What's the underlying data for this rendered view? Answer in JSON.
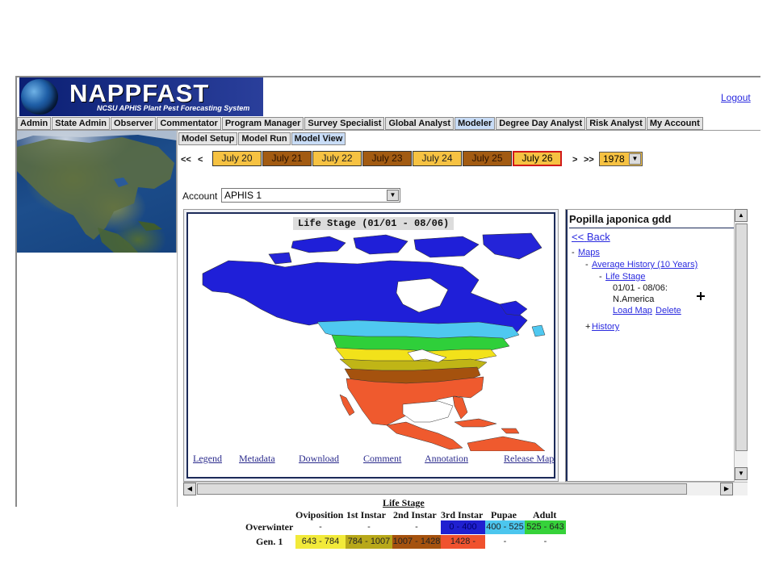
{
  "header": {
    "logo_title": "NAPPFAST",
    "logo_subtitle": "NCSU APHIS Plant Pest Forecasting System",
    "logout": "Logout"
  },
  "role_tabs": [
    "Admin",
    "State Admin",
    "Observer",
    "Commentator",
    "Program Manager",
    "Survey Specialist",
    "Global Analyst",
    "Modeler",
    "Degree Day Analyst",
    "Risk Analyst",
    "My Account"
  ],
  "active_role": "Modeler",
  "sub_tabs": [
    "Model Setup",
    "Model Run",
    "Model View"
  ],
  "active_sub_tab": "Model View",
  "date_nav": {
    "first": "<<",
    "prev": "<",
    "next": ">",
    "last": ">>",
    "days": [
      "July 20",
      "July 21",
      "July 22",
      "July 23",
      "July 24",
      "July 25",
      "July 26"
    ],
    "selected_day": "July 26",
    "year": "1978"
  },
  "account": {
    "label": "Account",
    "value": "APHIS 1"
  },
  "map": {
    "title": "Life Stage (01/01 - 08/06)",
    "links": [
      "Legend",
      "Metadata",
      "Download",
      "Comment",
      "Annotation",
      "Release Map"
    ]
  },
  "tree": {
    "title": "Popilla japonica gdd",
    "back_prefix": "<<",
    "back": "Back",
    "maps": "Maps",
    "average_history": "Average History (10 Years)",
    "life_stage": "Life Stage",
    "date_range": "01/01 - 08/06:",
    "region": "N.America",
    "load_map": "Load Map",
    "delete": "Delete",
    "history": "History",
    "bullet": "-",
    "expand": "+"
  },
  "legend": {
    "title": "Life Stage",
    "columns": [
      "Oviposition",
      "1st Instar",
      "2nd Instar",
      "3rd Instar",
      "Pupae",
      "Adult"
    ],
    "rows": [
      {
        "label": "Overwinter",
        "cells": [
          "-",
          "-",
          "-",
          "0 - 400",
          "400 - 525",
          "525 - 643"
        ]
      },
      {
        "label": "Gen. 1",
        "cells": [
          "643 - 784",
          "784 - 1007",
          "1007 - 1428",
          "1428 -",
          "-",
          "-"
        ]
      }
    ]
  },
  "colors": {
    "day_light": "#f6c242",
    "day_dark": "#a25b12",
    "selected_border": "#d11a1a",
    "link": "#2a2adf",
    "tab_active": "#c8dcf6"
  }
}
